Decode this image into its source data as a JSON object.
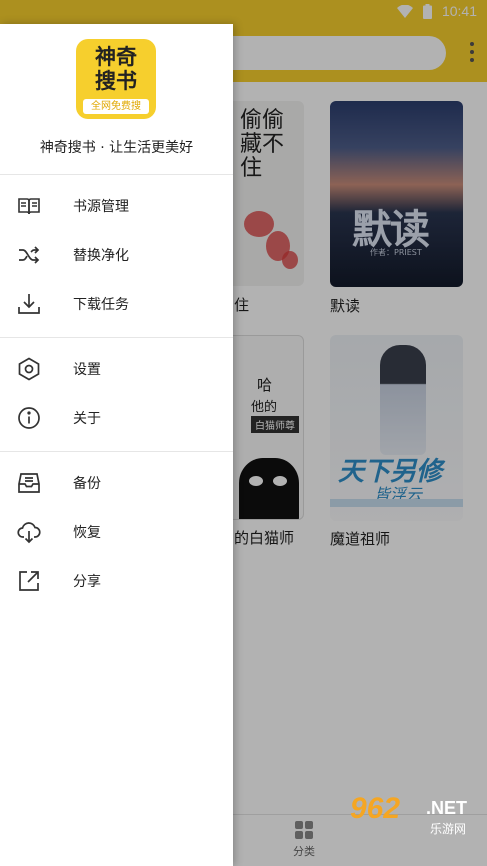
{
  "status_bar": {
    "time": "10:41",
    "background": "#f6cf2d"
  },
  "books": [
    {
      "title": "住",
      "cover_lines": [
        "偷偷",
        "藏不住"
      ]
    },
    {
      "title": "默读",
      "cover_big": "默读",
      "cover_small": "作者：PRIEST"
    },
    {
      "title": "的白猫师",
      "cover_lines": [
        "哈",
        "他的",
        "白猫师尊"
      ]
    },
    {
      "title": "魔道祖师",
      "cover_big": "天下另修",
      "cover_sub": "皆浮云"
    }
  ],
  "bottom_nav": {
    "category_label": "分类"
  },
  "watermark": {
    "number": "962",
    "net": ".NET",
    "site": "乐游网"
  },
  "drawer": {
    "logo": {
      "line1": "神奇",
      "line2": "搜书",
      "sub": "全网免费搜"
    },
    "slogan": "神奇搜书 · 让生活更美好",
    "items": [
      {
        "label": "书源管理",
        "icon": "book-open-icon"
      },
      {
        "label": "替换净化",
        "icon": "shuffle-icon"
      },
      {
        "label": "下载任务",
        "icon": "download-icon"
      },
      {
        "label": "设置",
        "icon": "hexagon-settings-icon"
      },
      {
        "label": "关于",
        "icon": "info-icon"
      },
      {
        "label": "备份",
        "icon": "inbox-backup-icon"
      },
      {
        "label": "恢复",
        "icon": "cloud-download-icon"
      },
      {
        "label": "分享",
        "icon": "share-external-icon"
      }
    ]
  },
  "colors": {
    "accent": "#f6cf2d",
    "icon": "#333333"
  }
}
